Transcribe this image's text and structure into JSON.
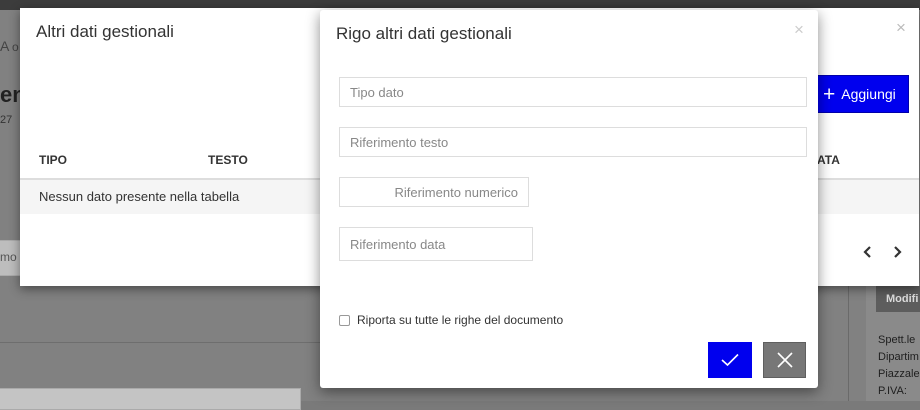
{
  "background": {
    "fragments": [
      "A",
      "o",
      "en",
      "27",
      "mo"
    ],
    "right_panel": {
      "button_label": "Modifi",
      "lines": [
        "Spett.le",
        "Dipartim",
        "Piazzale",
        "P.IVA:"
      ]
    }
  },
  "modal_outer": {
    "title": "Altri dati gestionali",
    "close_label": "×",
    "add_button_label": "Aggiungi",
    "table": {
      "columns": [
        "TIPO",
        "TESTO",
        "ATA"
      ],
      "empty_message": "Nessun dato presente nella tabella"
    },
    "pager": {
      "prev": "‹",
      "next": "›"
    }
  },
  "modal_inner": {
    "title": "Rigo altri dati gestionali",
    "close_label": "×",
    "fields": {
      "tipo_dato": {
        "placeholder": "Tipo dato",
        "value": ""
      },
      "riferimento_testo": {
        "placeholder": "Riferimento testo",
        "value": ""
      },
      "riferimento_numerico": {
        "placeholder": "Riferimento numerico",
        "value": ""
      },
      "riferimento_data": {
        "placeholder": "Riferimento data",
        "value": ""
      }
    },
    "checkbox": {
      "label": "Riporta su tutte le righe del documento",
      "checked": false
    },
    "confirm_icon": "check-icon",
    "cancel_icon": "close-icon"
  },
  "colors": {
    "primary": "#0000ee",
    "cancel": "#777777",
    "overlay": "#818181"
  }
}
